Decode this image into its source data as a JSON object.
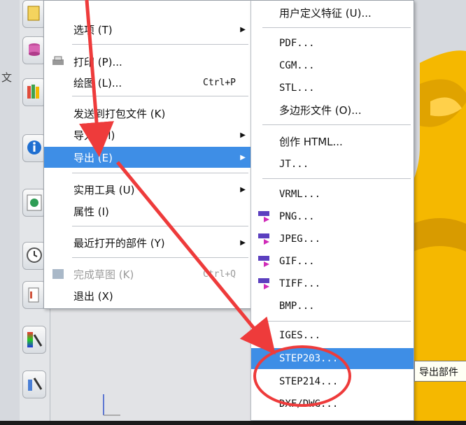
{
  "side_text": "文",
  "main_menu": {
    "items": [
      {
        "label": "选项 (T)",
        "arrow": "▶"
      },
      {
        "label": "打印 (P)..."
      },
      {
        "label": "绘图 (L)...",
        "shortcut": "Ctrl+P"
      },
      {
        "label": "发送到打包文件 (K)"
      },
      {
        "label": "导入 (M)",
        "arrow": "▶"
      },
      {
        "label": "导出 (E)",
        "arrow": "▶"
      },
      {
        "label": "实用工具 (U)",
        "arrow": "▶"
      },
      {
        "label": "属性 (I)"
      },
      {
        "label": "最近打开的部件 (Y)",
        "arrow": "▶"
      },
      {
        "label": "完成草图 (K)",
        "shortcut": "Ctrl+Q"
      },
      {
        "label": "退出 (X)"
      }
    ]
  },
  "export_submenu": {
    "items": [
      {
        "label": "用户定义特征 (U)..."
      },
      {
        "label": "PDF..."
      },
      {
        "label": "CGM..."
      },
      {
        "label": "STL..."
      },
      {
        "label": "多边形文件 (O)..."
      },
      {
        "label": "创作 HTML..."
      },
      {
        "label": "JT..."
      },
      {
        "label": "VRML..."
      },
      {
        "label": "PNG..."
      },
      {
        "label": "JPEG..."
      },
      {
        "label": "GIF..."
      },
      {
        "label": "TIFF..."
      },
      {
        "label": "BMP..."
      },
      {
        "label": "IGES..."
      },
      {
        "label": "STEP203..."
      },
      {
        "label": "STEP214..."
      },
      {
        "label": "DXF/DWG..."
      }
    ]
  },
  "tooltip": "导出部件",
  "colors": {
    "highlight": "#3e8ee6",
    "annotation": "#ee3b3b",
    "part": "#f5b800"
  }
}
